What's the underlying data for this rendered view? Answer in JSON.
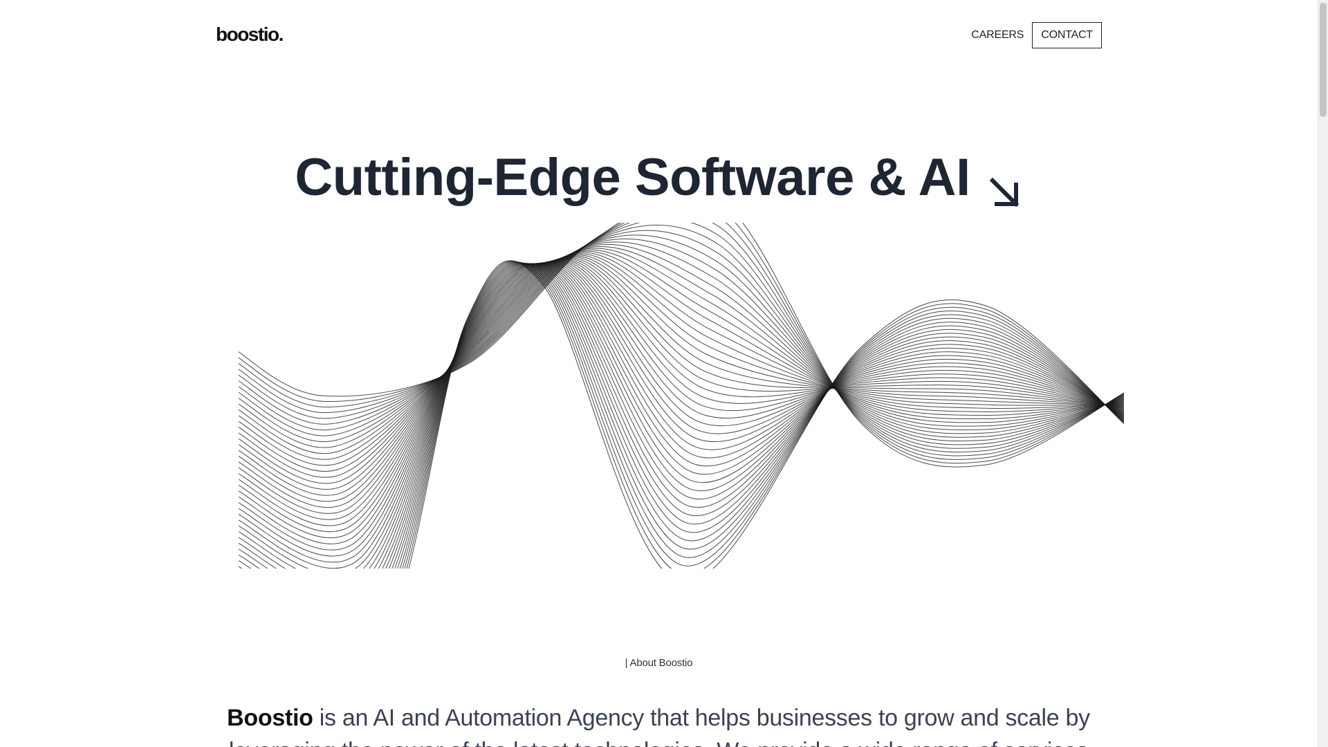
{
  "header": {
    "logo": "boostio.",
    "nav": {
      "careers_label": "CAREERS",
      "contact_label": "CONTACT"
    }
  },
  "hero": {
    "title": "Cutting-Edge Software & AI",
    "arrow_icon": "arrow-down-right-icon"
  },
  "about": {
    "tag": "| About Boostio",
    "brand": "Boostio",
    "text": " is an AI and Automation Agency that helps businesses to grow and scale by leveraging the power of the latest technologies. We provide a wide range of services"
  },
  "colors": {
    "heading": "#1e2533",
    "body_text": "#3b4252",
    "wave_stroke": "#1a1a1a"
  }
}
